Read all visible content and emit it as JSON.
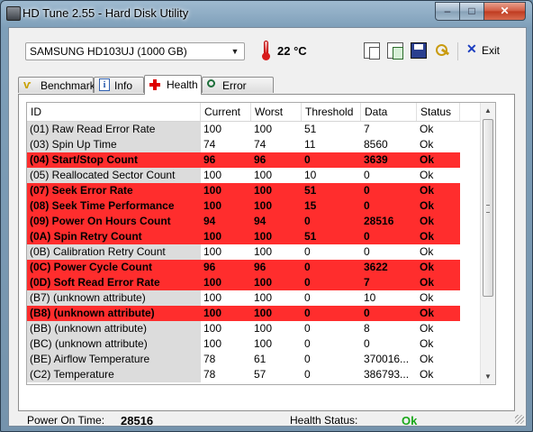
{
  "window": {
    "title": "HD Tune 2.55 - Hard Disk Utility",
    "minimize": "–",
    "maximize": "□",
    "close": "✕"
  },
  "toolbar": {
    "disk_selected": "SAMSUNG HD103UJ (1000 GB)",
    "temperature": "22 °C",
    "exit_label": "Exit",
    "icons": [
      "copy-text-icon",
      "copy-screenshot-icon",
      "save-icon",
      "options-keys-icon",
      "exit-icon",
      "thermometer-icon"
    ]
  },
  "tabs": [
    {
      "label": "Benchmark",
      "icon": "benchmark-icon"
    },
    {
      "label": "Info",
      "icon": "info-icon"
    },
    {
      "label": "Health",
      "icon": "health-cross-icon",
      "active": true
    },
    {
      "label": "Error Scan",
      "icon": "error-scan-icon"
    }
  ],
  "table": {
    "headers": [
      "ID",
      "Current",
      "Worst",
      "Threshold",
      "Data",
      "Status"
    ],
    "rows": [
      {
        "id": "(01) Raw Read Error Rate",
        "current": "100",
        "worst": "100",
        "threshold": "51",
        "data": "7",
        "status": "Ok",
        "highlight": false
      },
      {
        "id": "(03) Spin Up Time",
        "current": "74",
        "worst": "74",
        "threshold": "11",
        "data": "8560",
        "status": "Ok",
        "highlight": false
      },
      {
        "id": "(04) Start/Stop Count",
        "current": "96",
        "worst": "96",
        "threshold": "0",
        "data": "3639",
        "status": "Ok",
        "highlight": true
      },
      {
        "id": "(05) Reallocated Sector Count",
        "current": "100",
        "worst": "100",
        "threshold": "10",
        "data": "0",
        "status": "Ok",
        "highlight": false
      },
      {
        "id": "(07) Seek Error Rate",
        "current": "100",
        "worst": "100",
        "threshold": "51",
        "data": "0",
        "status": "Ok",
        "highlight": true
      },
      {
        "id": "(08) Seek Time Performance",
        "current": "100",
        "worst": "100",
        "threshold": "15",
        "data": "0",
        "status": "Ok",
        "highlight": true
      },
      {
        "id": "(09) Power On Hours Count",
        "current": "94",
        "worst": "94",
        "threshold": "0",
        "data": "28516",
        "status": "Ok",
        "highlight": true
      },
      {
        "id": "(0A) Spin Retry Count",
        "current": "100",
        "worst": "100",
        "threshold": "51",
        "data": "0",
        "status": "Ok",
        "highlight": true
      },
      {
        "id": "(0B) Calibration Retry Count",
        "current": "100",
        "worst": "100",
        "threshold": "0",
        "data": "0",
        "status": "Ok",
        "highlight": false
      },
      {
        "id": "(0C) Power Cycle Count",
        "current": "96",
        "worst": "96",
        "threshold": "0",
        "data": "3622",
        "status": "Ok",
        "highlight": true
      },
      {
        "id": "(0D) Soft Read Error Rate",
        "current": "100",
        "worst": "100",
        "threshold": "0",
        "data": "7",
        "status": "Ok",
        "highlight": true
      },
      {
        "id": "(B7) (unknown attribute)",
        "current": "100",
        "worst": "100",
        "threshold": "0",
        "data": "10",
        "status": "Ok",
        "highlight": false
      },
      {
        "id": "(B8) (unknown attribute)",
        "current": "100",
        "worst": "100",
        "threshold": "0",
        "data": "0",
        "status": "Ok",
        "highlight": true
      },
      {
        "id": "(BB) (unknown attribute)",
        "current": "100",
        "worst": "100",
        "threshold": "0",
        "data": "8",
        "status": "Ok",
        "highlight": false
      },
      {
        "id": "(BC) (unknown attribute)",
        "current": "100",
        "worst": "100",
        "threshold": "0",
        "data": "0",
        "status": "Ok",
        "highlight": false
      },
      {
        "id": "(BE) Airflow Temperature",
        "current": "78",
        "worst": "61",
        "threshold": "0",
        "data": "370016...",
        "status": "Ok",
        "highlight": false
      },
      {
        "id": "(C2) Temperature",
        "current": "78",
        "worst": "57",
        "threshold": "0",
        "data": "386793...",
        "status": "Ok",
        "highlight": false
      }
    ]
  },
  "footer": {
    "power_on_label": "Power On Time:",
    "power_on_value": "28516",
    "health_label": "Health Status:",
    "health_value": "Ok"
  },
  "colors": {
    "highlight_row": "#ff2d2d",
    "health_ok": "#1aa81a",
    "id_column_bg": "#dcdcdc"
  }
}
